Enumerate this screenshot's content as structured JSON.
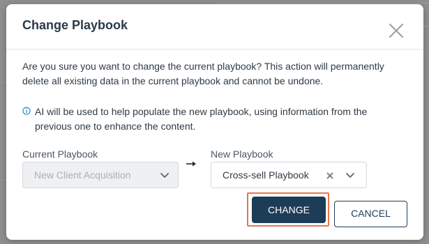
{
  "dialog": {
    "title": "Change Playbook",
    "message": "Are you sure you want to change the current playbook? This action will permanently delete all existing data in the current playbook and cannot be undone.",
    "info_message": "AI will be used to help populate the new playbook, using information from the previous one to enhance the content."
  },
  "current_playbook": {
    "label": "Current Playbook",
    "value": "New Client Acquisition"
  },
  "new_playbook": {
    "label": "New Playbook",
    "value": "Cross-sell Playbook"
  },
  "buttons": {
    "change": "CHANGE",
    "cancel": "CANCEL"
  },
  "colors": {
    "primary": "#1d3c58",
    "focus": "#e8764c",
    "info": "#2a8fc6"
  }
}
